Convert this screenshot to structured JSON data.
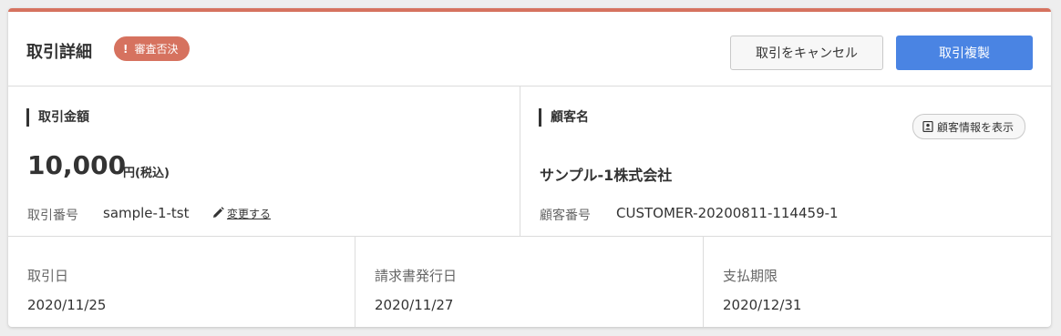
{
  "header": {
    "title": "取引詳細",
    "status_badge": {
      "icon": "!",
      "label": "審査否決",
      "color": "#d6725f"
    },
    "cancel_button": "取引をキャンセル",
    "copy_button": "取引複製",
    "accent_color": "#d6725f",
    "primary_color": "#4a84e3"
  },
  "amount_section": {
    "label": "取引金額",
    "amount": "10,000",
    "unit": "円(税込)",
    "transaction_number_label": "取引番号",
    "transaction_number": "sample-1-tst",
    "change_link": "変更する",
    "change_icon": "pencil-icon"
  },
  "customer_section": {
    "label": "顧客名",
    "show_info_button": "顧客情報を表示",
    "show_info_icon": "contact-card-icon",
    "customer_name": "サンプル-1株式会社",
    "customer_number_label": "顧客番号",
    "customer_number": "CUSTOMER-20200811-114459-1"
  },
  "dates": [
    {
      "label": "取引日",
      "value": "2020/11/25"
    },
    {
      "label": "請求書発行日",
      "value": "2020/11/27"
    },
    {
      "label": "支払期限",
      "value": "2020/12/31"
    }
  ]
}
